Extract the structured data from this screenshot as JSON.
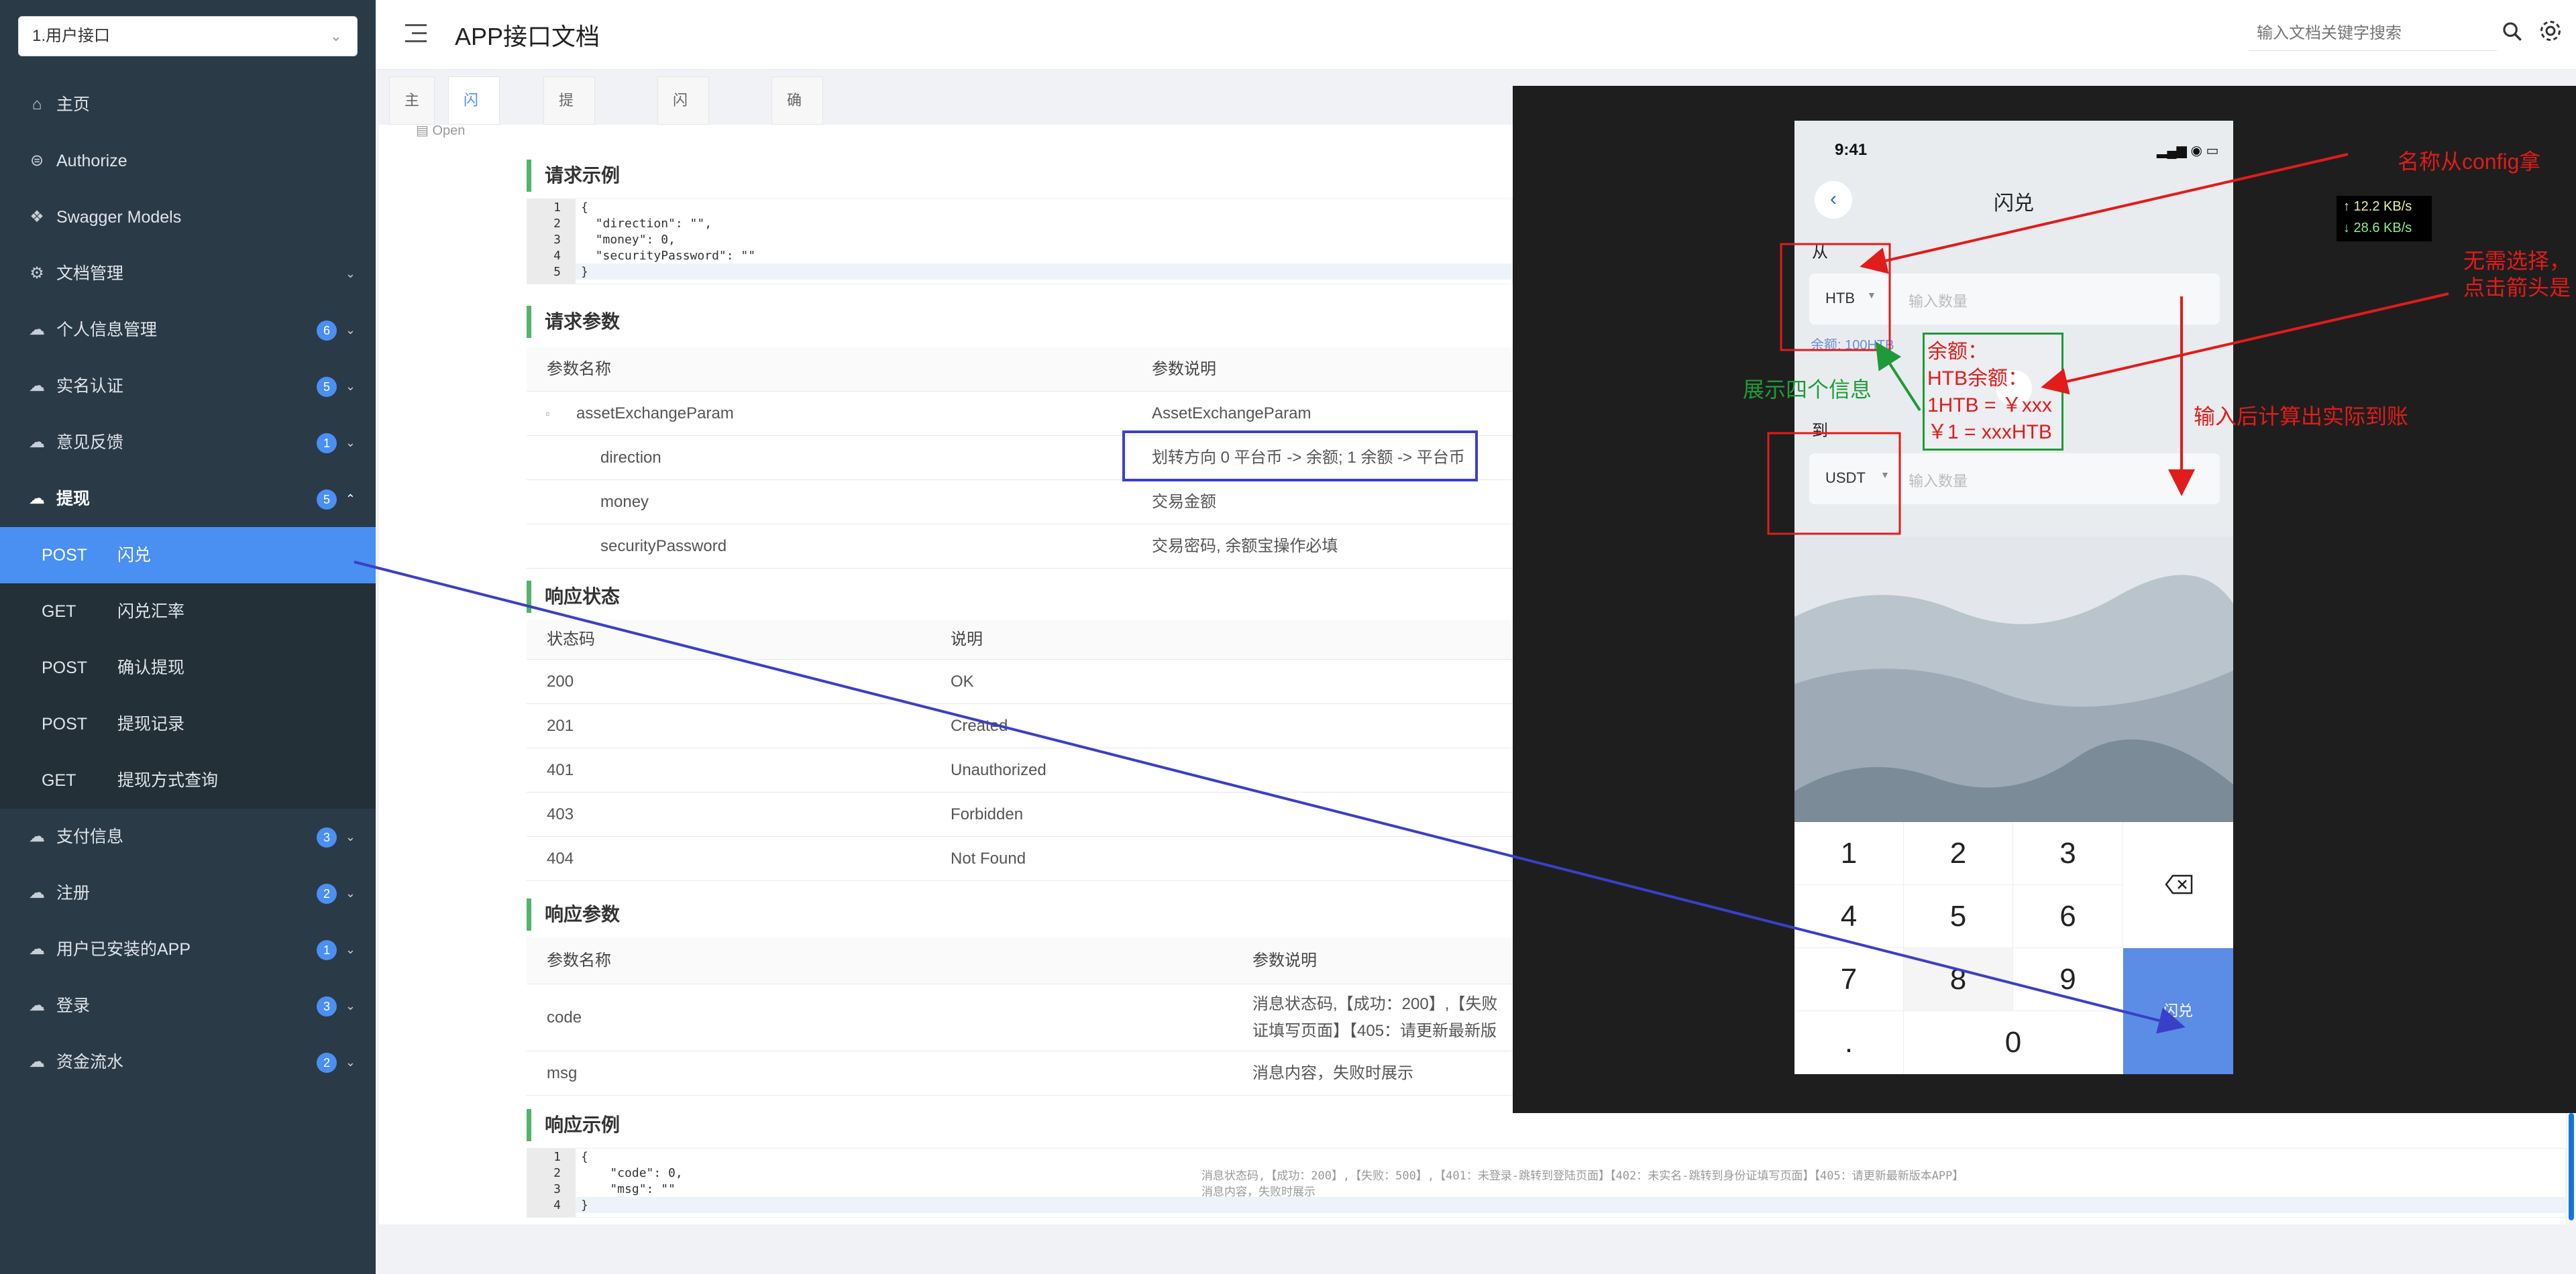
{
  "sidebar": {
    "group_select": "1.用户接口",
    "items": [
      {
        "icon": "home-icon",
        "label": "主页"
      },
      {
        "icon": "shield-icon",
        "label": "Authorize"
      },
      {
        "icon": "cube-icon",
        "label": "Swagger Models"
      },
      {
        "icon": "document-settings-icon",
        "label": "文档管理"
      },
      {
        "icon": "cloud-icon",
        "label": "个人信息管理",
        "badge": "6"
      },
      {
        "icon": "cloud-icon",
        "label": "实名认证",
        "badge": "5"
      },
      {
        "icon": "cloud-icon",
        "label": "意见反馈",
        "badge": "1"
      },
      {
        "icon": "cloud-icon",
        "label": "提现",
        "badge": "5"
      }
    ],
    "sub_items": [
      {
        "method": "POST",
        "label": "闪兑"
      },
      {
        "method": "GET",
        "label": "闪兑汇率"
      },
      {
        "method": "POST",
        "label": "确认提现"
      },
      {
        "method": "POST",
        "label": "提现记录"
      },
      {
        "method": "GET",
        "label": "提现方式查询"
      }
    ],
    "more_items": [
      {
        "label": "支付信息",
        "badge": "3"
      },
      {
        "label": "注册",
        "badge": "2"
      },
      {
        "label": "用户已安装的APP",
        "badge": "1"
      },
      {
        "label": "登录",
        "badge": "3"
      },
      {
        "label": "资金流水",
        "badge": "2"
      }
    ]
  },
  "header": {
    "title": "APP接口文档",
    "search_placeholder": "输入文档关键字搜索"
  },
  "tabs": [
    "主页",
    "闪兑",
    "提现记录",
    "闪兑汇率",
    "确认提现"
  ],
  "doc": {
    "open_label": "Open",
    "request_example_title": "请求示例",
    "request_example_lines": [
      "1",
      "2",
      "3",
      "4",
      "5"
    ],
    "request_example_code": [
      "{",
      "  \"direction\": \"\",",
      "  \"money\": 0,",
      "  \"securityPassword\": \"\"",
      "}"
    ],
    "request_params_title": "请求参数",
    "params_head": {
      "name": "参数名称",
      "desc": "参数说明"
    },
    "params": [
      {
        "name": "assetExchangeParam",
        "desc": "AssetExchangeParam"
      },
      {
        "name": "direction",
        "desc": "划转方向 0 平台币 -> 余额; 1 余额 -> 平台币"
      },
      {
        "name": "money",
        "desc": "交易金额"
      },
      {
        "name": "securityPassword",
        "desc": "交易密码, 余额宝操作必填"
      }
    ],
    "response_status_title": "响应状态",
    "status_head": {
      "code": "状态码",
      "desc": "说明"
    },
    "statuses": [
      {
        "code": "200",
        "desc": "OK"
      },
      {
        "code": "201",
        "desc": "Created"
      },
      {
        "code": "401",
        "desc": "Unauthorized"
      },
      {
        "code": "403",
        "desc": "Forbidden"
      },
      {
        "code": "404",
        "desc": "Not Found"
      }
    ],
    "response_params_title": "响应参数",
    "resp_head": {
      "name": "参数名称",
      "desc": "参数说明"
    },
    "resp_params": [
      {
        "name": "code",
        "desc1": "消息状态码,【成功：200】,【失败",
        "desc2": "证填写页面】【405：请更新最新版"
      },
      {
        "name": "msg",
        "desc1": "消息内容，失败时展示"
      }
    ],
    "response_example_title": "响应示例",
    "response_example_lines": [
      "1",
      "2",
      "3",
      "4"
    ],
    "response_example_code": [
      "{",
      "    \"code\": 0,",
      "    \"msg\": \"\"",
      "}"
    ],
    "response_example_comment1": "消息状态码,【成功：200】,【失败：500】,【401：未登录-跳转到登陆页面】【402：未实名-跳转到身份证填写页面】【405：请更新最新版本APP】",
    "response_example_comment2": "消息内容，失败时展示"
  },
  "phone": {
    "time": "9:41",
    "title": "闪兑",
    "from_label": "从",
    "from_coin": "HTB",
    "amount_placeholder": "输入数量",
    "balance": "余额: 100HTB",
    "to_label": "到",
    "to_coin": "USDT",
    "keys": [
      "1",
      "2",
      "3",
      "4",
      "5",
      "6",
      "7",
      "8",
      "9",
      ".",
      "0"
    ],
    "submit": "闪兑"
  },
  "speed": {
    "up": "↑ 12.2 KB/s",
    "down": "↓ 28.6 KB/s"
  },
  "annotations": {
    "config_name": "名称从config拿",
    "no_select_1": "无需选择，",
    "no_select_2": "点击箭头是",
    "show_four": "展示四个信息",
    "balance_box": [
      "余额：",
      "HTB余额：",
      "1HTB = ￥xxx",
      "￥1 = xxxHTB"
    ],
    "compute": "输入后计算出实际到账"
  },
  "colors": {
    "accent": "#4a8ff2",
    "sidebar": "#2b3a47",
    "annotation_red": "#e21b1b",
    "annotation_green": "#1f9a3a",
    "annotation_blue": "#3a3fc9"
  }
}
